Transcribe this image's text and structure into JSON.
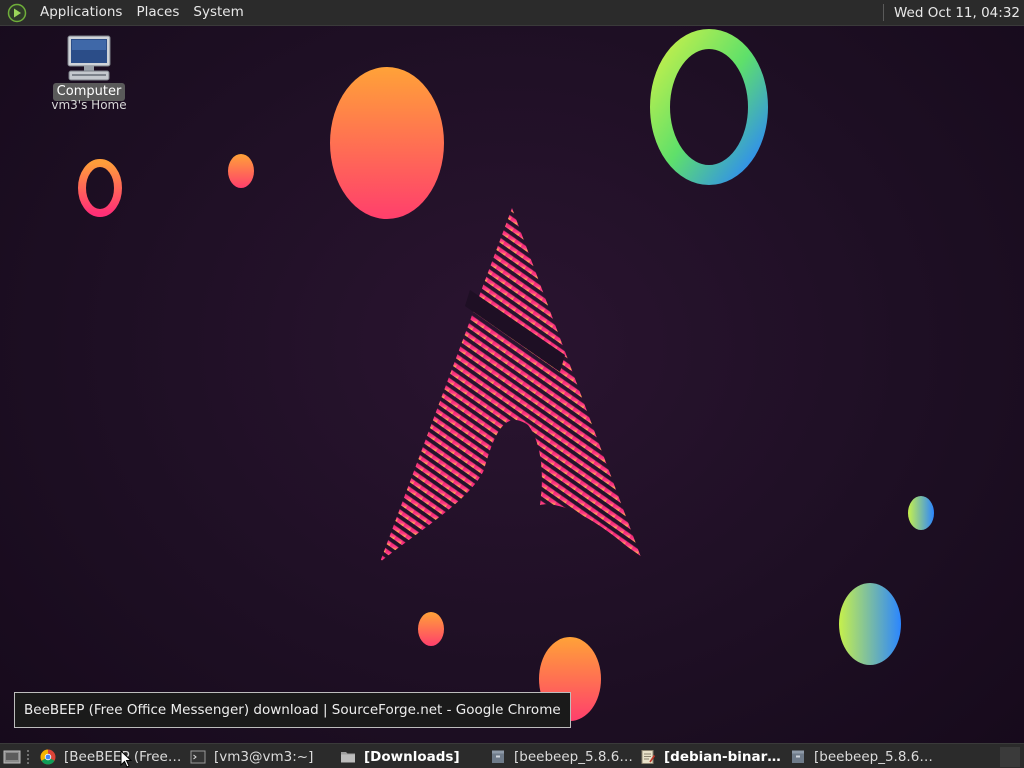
{
  "top_panel": {
    "menus": [
      "Applications",
      "Places",
      "System"
    ],
    "clock": "Wed Oct 11, 04:32",
    "logo_icon": "mate-menu-icon"
  },
  "desktop": {
    "icon_label": "Computer",
    "icon_sublabel": "vm3's Home",
    "icon_name": "computer-icon"
  },
  "tooltip": {
    "text": "BeeBEEP (Free Office Messenger) download | SourceForge.net - Google Chrome"
  },
  "taskbar": {
    "tasks": [
      {
        "label": "[BeeBEEP (Free ...",
        "icon": "chrome-icon",
        "active": false
      },
      {
        "label": "[vm3@vm3:~]",
        "icon": "terminal-icon",
        "active": false
      },
      {
        "label": "[Downloads]",
        "icon": "folder-icon",
        "active": true
      },
      {
        "label": "[beebeep_5.8.6_...",
        "icon": "archive-icon",
        "active": false
      },
      {
        "label": "[debian-binary (...",
        "icon": "text-editor-icon",
        "active": true
      },
      {
        "label": "[beebeep_5.8.6_...",
        "icon": "archive-icon",
        "active": false
      }
    ]
  },
  "colors": {
    "panel": "#2b2b2b",
    "wallpaper_bg": "#1e0f24",
    "orange": "#ff9a3c",
    "pink": "#ff2f7a",
    "green": "#b8f04a",
    "blue": "#2f8cff"
  }
}
